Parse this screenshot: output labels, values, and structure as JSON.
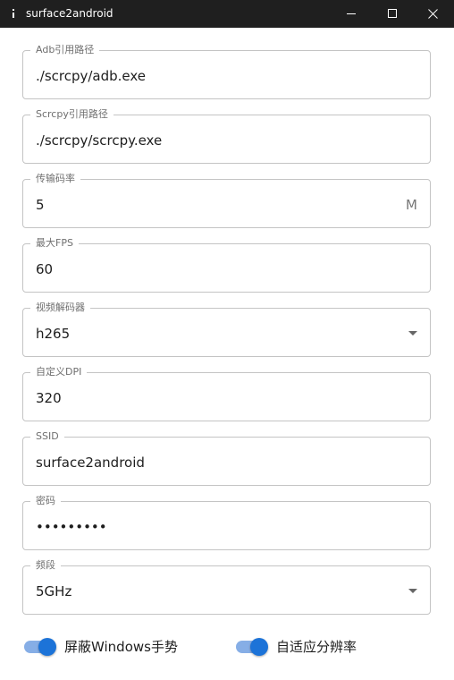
{
  "window": {
    "title": "surface2android"
  },
  "fields": {
    "adb_path": {
      "label": "Adb引用路径",
      "value": "./scrcpy/adb.exe"
    },
    "scrcpy_path": {
      "label": "Scrcpy引用路径",
      "value": "./scrcpy/scrcpy.exe"
    },
    "bitrate": {
      "label": "传输码率",
      "value": "5",
      "suffix": "M"
    },
    "max_fps": {
      "label": "最大FPS",
      "value": "60"
    },
    "video_decoder": {
      "label": "视频解码器",
      "value": "h265"
    },
    "custom_dpi": {
      "label": "自定义DPI",
      "value": "320"
    },
    "ssid": {
      "label": "SSID",
      "value": "surface2android"
    },
    "password": {
      "label": "密码",
      "value": "•••••••••"
    },
    "band": {
      "label": "频段",
      "value": "5GHz"
    }
  },
  "toggles": {
    "block_gestures": {
      "label": "屏蔽Windows手势",
      "on": true
    },
    "adaptive_resolution": {
      "label": "自适应分辨率",
      "on": true
    }
  },
  "colors": {
    "titlebar": "#1f1f1f",
    "accent": "#1c73d8",
    "track": "#86aee6",
    "border": "#c4c4c4"
  }
}
